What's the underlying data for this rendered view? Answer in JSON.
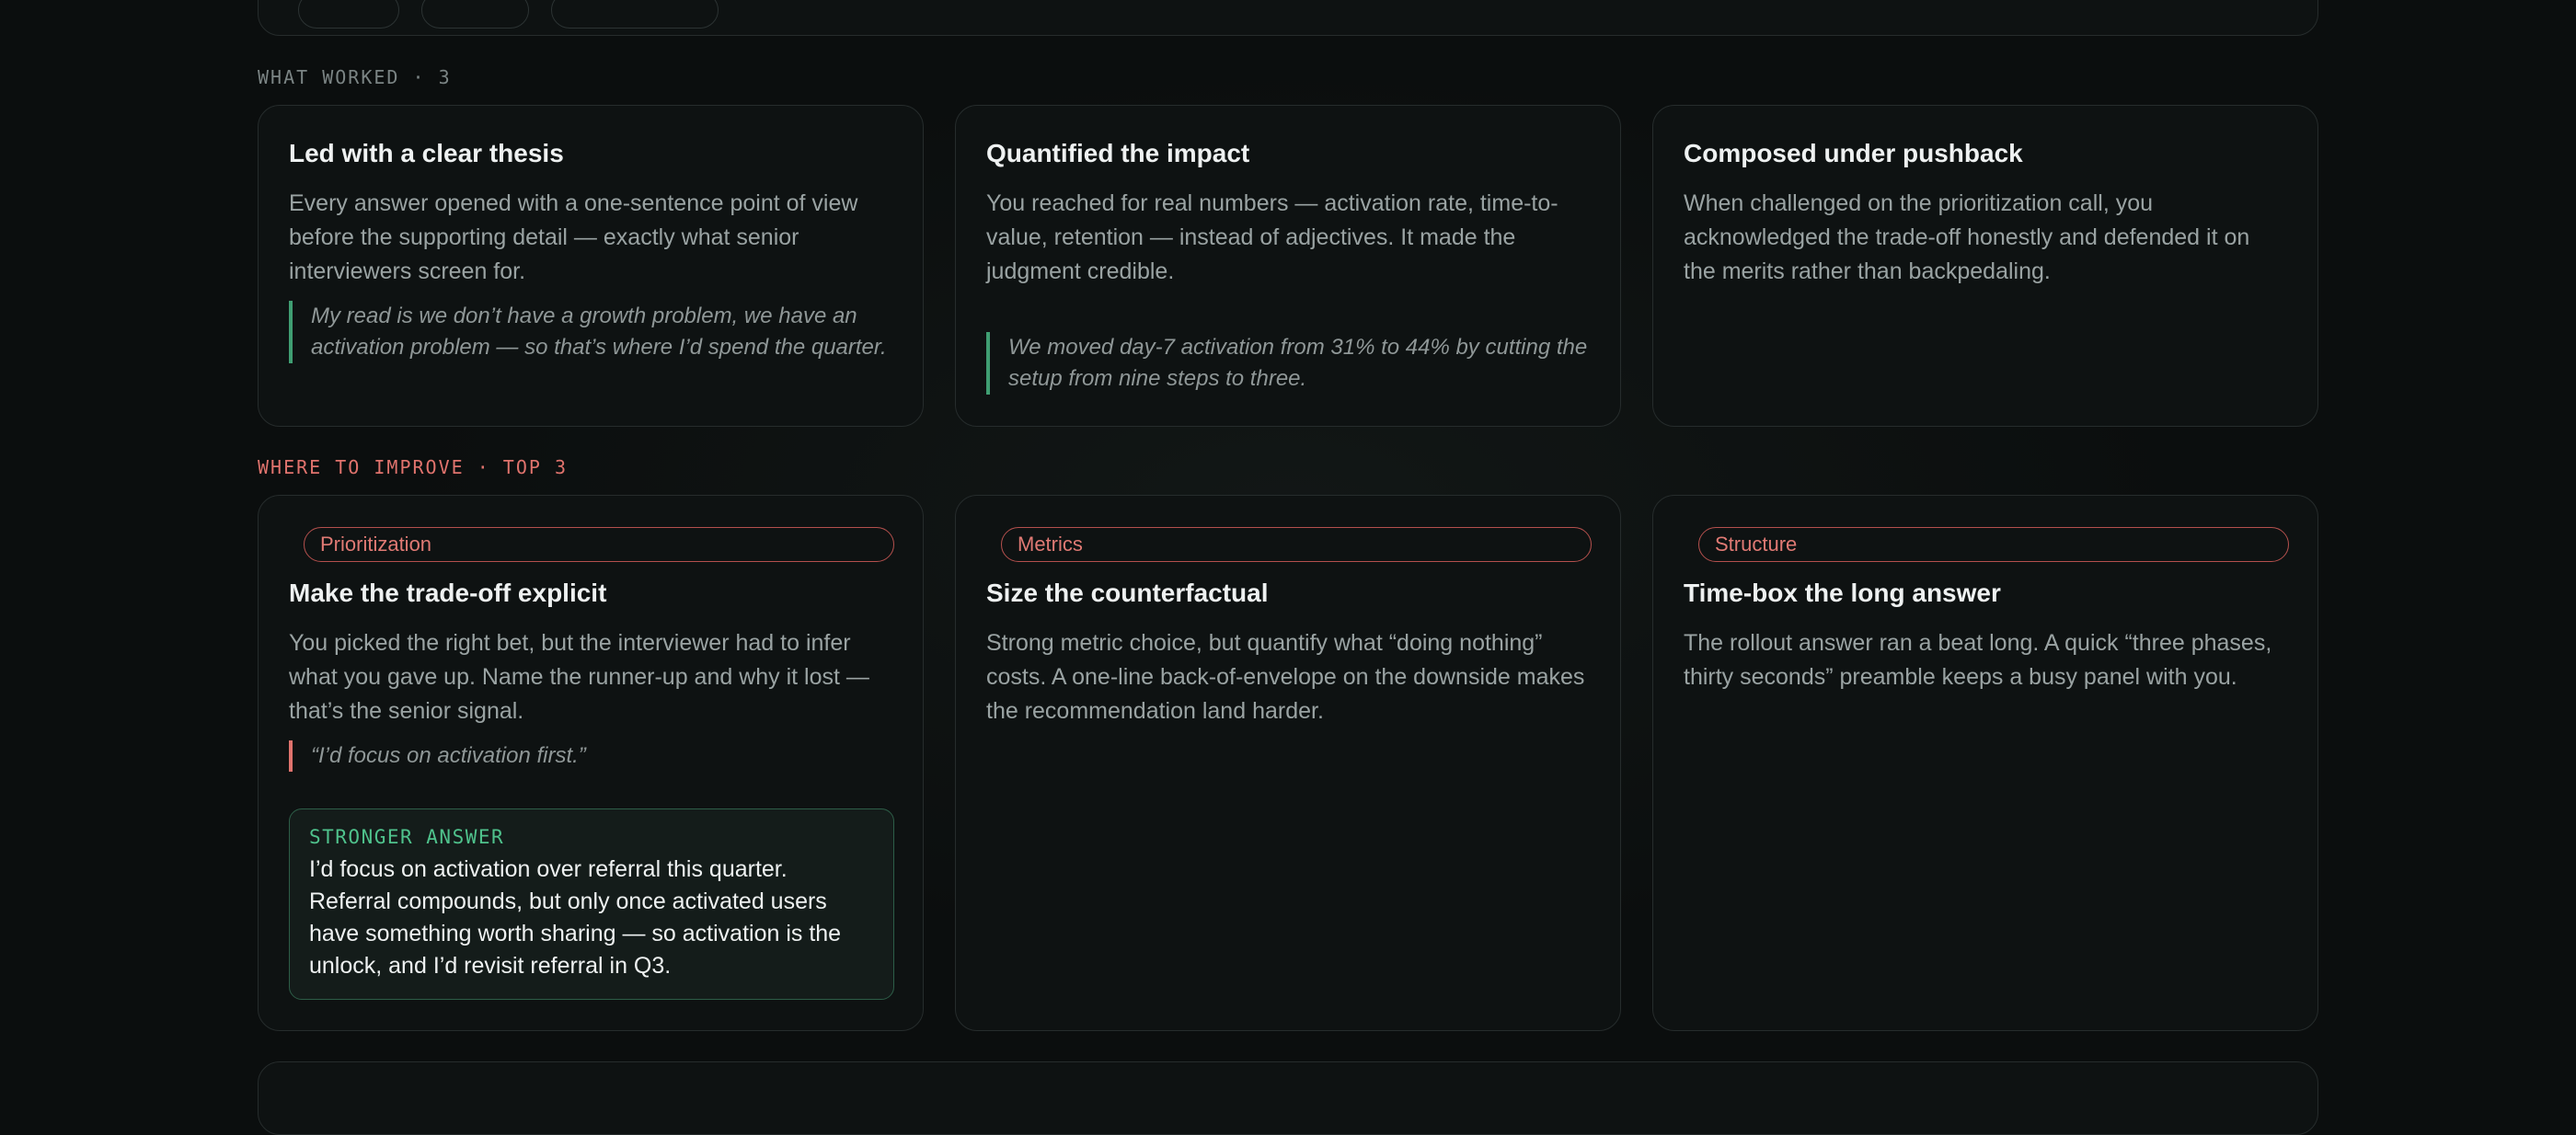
{
  "sections": {
    "worked_label": "WHAT WORKED · 3",
    "improve_label": "WHERE TO IMPROVE · TOP 3"
  },
  "worked": [
    {
      "title": "Led with a clear thesis",
      "body": "Every answer opened with a one-sentence point of view before the supporting detail — exactly what senior interviewers screen for.",
      "quote": "My read is we don’t have a growth problem, we have an activation problem — so that’s where I’d spend the quarter."
    },
    {
      "title": "Quantified the impact",
      "body": "You reached for real numbers — activation rate, time-to-value, retention — instead of adjectives. It made the judgment credible.",
      "quote": "We moved day-7 activation from 31% to 44% by cutting the setup from nine steps to three."
    },
    {
      "title": "Composed under pushback",
      "body": "When challenged on the prioritization call, you acknowledged the trade-off honestly and defended it on the merits rather than backpedaling."
    }
  ],
  "improve": [
    {
      "tag": "Prioritization",
      "title": "Make the trade-off explicit",
      "body": "You picked the right bet, but the interviewer had to infer what you gave up. Name the runner-up and why it lost — that’s the senior signal.",
      "quote": "“I’d focus on activation first.”",
      "stronger_label": "STRONGER ANSWER",
      "stronger_text": "I’d focus on activation over referral this quarter. Referral compounds, but only once activated users have something worth sharing — so activation is the unlock, and I’d revisit referral in Q3."
    },
    {
      "tag": "Metrics",
      "title": "Size the counterfactual",
      "body": "Strong metric choice, but quantify what “doing nothing” costs. A one-line back-of-envelope on the downside makes the recommendation land harder."
    },
    {
      "tag": "Structure",
      "title": "Time-box the long answer",
      "body": "The rollout answer ran a beat long. A quick “three phases, thirty seconds” preamble keeps a busy panel with you."
    }
  ],
  "colors": {
    "positive_accent": "#3f9e72",
    "improve_accent": "#e0736d"
  }
}
